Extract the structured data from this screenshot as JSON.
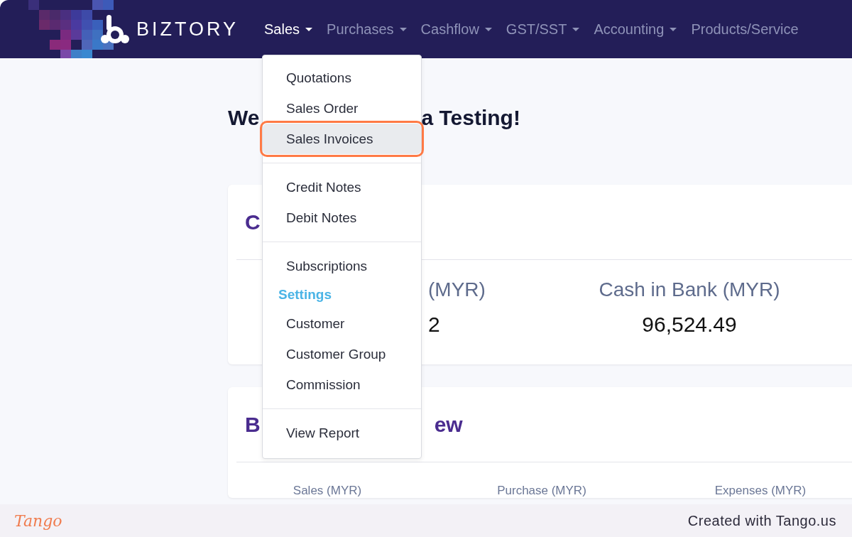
{
  "nav": {
    "brand": "BIZTORY",
    "items": [
      {
        "label": "Sales",
        "selected": true
      },
      {
        "label": "Purchases",
        "selected": false
      },
      {
        "label": "Cashflow",
        "selected": false
      },
      {
        "label": "GST/SST",
        "selected": false
      },
      {
        "label": "Accounting",
        "selected": false
      },
      {
        "label": "Products/Service",
        "selected": false
      }
    ]
  },
  "heading": {
    "visible_parts": [
      "We",
      "a Testing!"
    ]
  },
  "cash_card": {
    "title_visible": "C",
    "stats": [
      {
        "label": "(MYR)",
        "value": "2"
      },
      {
        "label": "Cash in Bank (MYR)",
        "value": "96,524.49"
      }
    ]
  },
  "business_card": {
    "title_parts": [
      "B",
      "ew"
    ],
    "columns": [
      "Sales (MYR)",
      "Purchase (MYR)",
      "Expenses (MYR)"
    ]
  },
  "menu": {
    "sections": [
      {
        "items": [
          {
            "kind": "item",
            "label": "Quotations",
            "selected": false
          },
          {
            "kind": "item",
            "label": "Sales Order",
            "selected": false
          },
          {
            "kind": "item",
            "label": "Sales Invoices",
            "selected": true
          }
        ]
      },
      {
        "items": [
          {
            "kind": "item",
            "label": "Credit Notes",
            "selected": false
          },
          {
            "kind": "item",
            "label": "Debit Notes",
            "selected": false
          }
        ]
      },
      {
        "items": [
          {
            "kind": "item",
            "label": "Subscriptions",
            "selected": false
          },
          {
            "kind": "header",
            "label": "Settings"
          },
          {
            "kind": "item",
            "label": "Customer",
            "selected": false
          },
          {
            "kind": "item",
            "label": "Customer Group",
            "selected": false
          },
          {
            "kind": "item",
            "label": "Commission",
            "selected": false
          }
        ]
      },
      {
        "items": [
          {
            "kind": "item",
            "label": "View Report",
            "selected": false
          }
        ]
      }
    ]
  },
  "footer": {
    "logo": "Tango",
    "credit": "Created with Tango.us"
  }
}
